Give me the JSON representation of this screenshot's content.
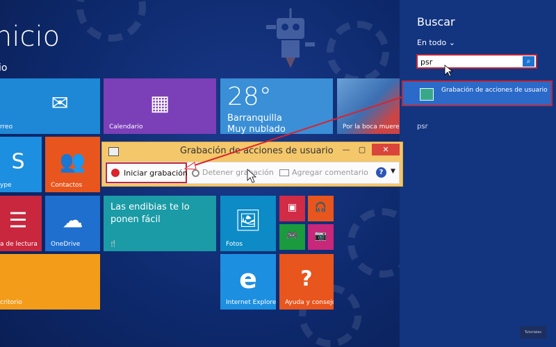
{
  "start": {
    "title": "Inicio",
    "title_visible": "nicio",
    "user_visible": "io",
    "tiles": [
      {
        "label": "Correo",
        "visible": "rreo",
        "icon": "mail-icon",
        "color": "#1e88d7"
      },
      {
        "label": "Calendario",
        "icon": "calendar-icon",
        "color": "#7b3fb8"
      },
      {
        "label": "Skype",
        "visible": "ype",
        "icon": "skype-icon",
        "color": "#1d8fe0"
      },
      {
        "label": "Contactos",
        "icon": "people-icon",
        "color": "#e8551d"
      },
      {
        "label": "Lista de lectura",
        "visible": "a de lectura",
        "icon": "reading-list-icon",
        "color": "#c8273d"
      },
      {
        "label": "OneDrive",
        "icon": "cloud-icon",
        "color": "#1f6fcf"
      },
      {
        "label": "Escritorio",
        "visible": "critorio",
        "color": "#f39c1a"
      },
      {
        "label": "Fotos",
        "icon": "photo-icon",
        "color": "#0c8bc6"
      },
      {
        "label": "Internet Explorer",
        "icon": "ie-icon",
        "color": "#1d8fe0"
      },
      {
        "label": "Ayuda y consejos",
        "icon": "help-icon",
        "color": "#e8551d"
      }
    ],
    "weather": {
      "temp": "28°",
      "city": "Barranquilla",
      "condition": "Muy nublado"
    },
    "sport": {
      "label": "Por la boca muere"
    },
    "food": {
      "text": "Las endibias te lo ponen fácil"
    }
  },
  "search": {
    "title": "Buscar",
    "scope": "En todo",
    "query": "psr",
    "result_label": "Grabación de acciones de usuario",
    "suggestion": "psr"
  },
  "psr_window": {
    "title": "Grabación de acciones de usuario",
    "start_label": "Iniciar grabación",
    "stop_label": "Detener grabación",
    "comment_label": "Agregar comentario",
    "help": "?"
  },
  "watermark": "Tutoriales"
}
